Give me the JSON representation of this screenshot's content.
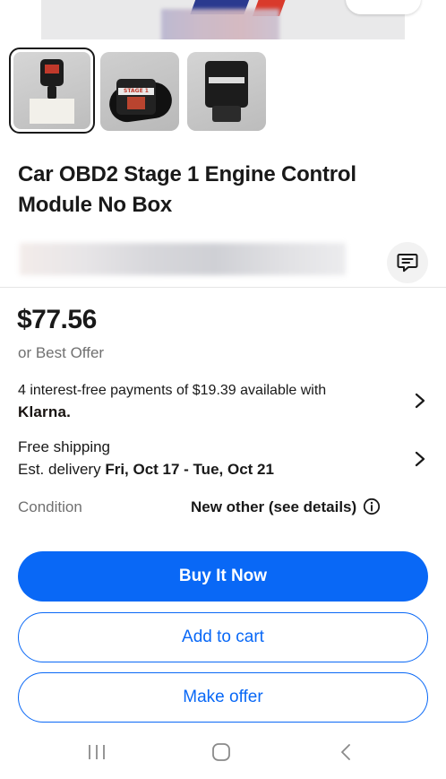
{
  "product": {
    "title": "Car OBD2 Stage 1 Engine Control Module No Box",
    "thumbnail_label": "STAGE 1"
  },
  "pricing": {
    "price": "$77.56",
    "best_offer": "or Best Offer",
    "installments_text": "4 interest-free payments of $19.39 available with",
    "installments_provider": "Klarna."
  },
  "shipping": {
    "free_shipping": "Free shipping",
    "delivery_prefix": "Est. delivery ",
    "delivery_dates": "Fri, Oct 17 - Tue, Oct 21"
  },
  "condition": {
    "label": "Condition",
    "value": "New other (see details)"
  },
  "actions": {
    "buy_now": "Buy It Now",
    "add_to_cart": "Add to cart",
    "make_offer": "Make offer"
  },
  "icons": {
    "chat": "message-icon",
    "chevron": "chevron-right-icon",
    "info": "info-icon",
    "nav_recent": "recent-apps-icon",
    "nav_home": "home-icon",
    "nav_back": "back-icon"
  },
  "colors": {
    "primary": "#0968f6",
    "text": "#191919",
    "muted": "#707070"
  }
}
